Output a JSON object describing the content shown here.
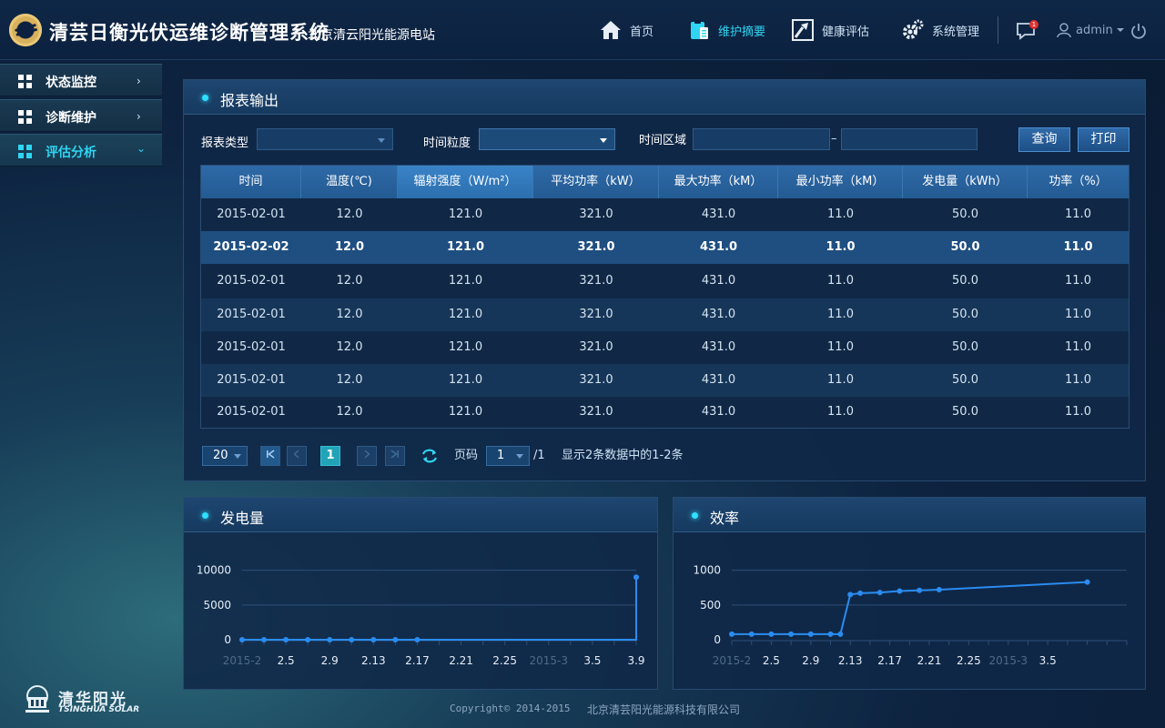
{
  "header": {
    "title": "清芸日衡光伏运维诊断管理系统",
    "subtitle": "北京清云阳光能源电站",
    "nav": [
      {
        "label": "首页",
        "icon": "home-icon",
        "active": false
      },
      {
        "label": "维护摘要",
        "icon": "clipboard-icon",
        "active": true
      },
      {
        "label": "健康评估",
        "icon": "trend-icon",
        "active": false
      },
      {
        "label": "系统管理",
        "icon": "gears-icon",
        "active": false
      }
    ],
    "message_badge": "1",
    "user": "admin"
  },
  "sidebar": {
    "items": [
      {
        "label": "状态监控",
        "chevron": "›"
      },
      {
        "label": "诊断维护",
        "chevron": "›"
      },
      {
        "label": "评估分析",
        "chevron": "⌄"
      }
    ],
    "brand_cn": "清华阳光",
    "brand_en": "TSINGHUA SOLAR"
  },
  "report": {
    "title": "报表输出",
    "filters": {
      "type_label": "报表类型",
      "type_value": "",
      "granularity_label": "时间粒度",
      "granularity_value": "",
      "range_label": "时间区域",
      "range_start": "",
      "range_end": "",
      "range_sep": "–"
    },
    "buttons": {
      "query": "查询",
      "print": "打印"
    },
    "columns": [
      "时间",
      "温度(℃)",
      "辐射强度（W/m²）",
      "平均功率（kW）",
      "最大功率（kM）",
      "最小功率（kM）",
      "发电量（kWh）",
      "功率（%）"
    ],
    "rows": [
      [
        "2015-02-01",
        "12.0",
        "121.0",
        "321.0",
        "431.0",
        "11.0",
        "50.0",
        "11.0"
      ],
      [
        "2015-02-02",
        "12.0",
        "121.0",
        "321.0",
        "431.0",
        "11.0",
        "50.0",
        "11.0"
      ],
      [
        "2015-02-01",
        "12.0",
        "121.0",
        "321.0",
        "431.0",
        "11.0",
        "50.0",
        "11.0"
      ],
      [
        "2015-02-01",
        "12.0",
        "121.0",
        "321.0",
        "431.0",
        "11.0",
        "50.0",
        "11.0"
      ],
      [
        "2015-02-01",
        "12.0",
        "121.0",
        "321.0",
        "431.0",
        "11.0",
        "50.0",
        "11.0"
      ],
      [
        "2015-02-01",
        "12.0",
        "121.0",
        "321.0",
        "431.0",
        "11.0",
        "50.0",
        "11.0"
      ],
      [
        "2015-02-01",
        "12.0",
        "121.0",
        "321.0",
        "431.0",
        "11.0",
        "50.0",
        "11.0"
      ]
    ],
    "pagination": {
      "page_size": "20",
      "current_page": "1",
      "page_label": "页码",
      "page_value": "1",
      "total_pages": "/1",
      "summary": "显示2条数据中的1-2条"
    }
  },
  "chart_data": [
    {
      "type": "line",
      "title": "发电量",
      "x_ticks": [
        "2015-2",
        "2.5",
        "2.9",
        "2.13",
        "2.17",
        "2.21",
        "2.25",
        "2015-3",
        "3.5",
        "3.9"
      ],
      "x_ticks_dim": [
        "2015-2",
        "2015-3"
      ],
      "y_ticks": [
        0,
        5000,
        10000
      ],
      "ylim": [
        0,
        11000
      ],
      "series": [
        {
          "values": [
            {
              "x": "2015-02-01",
              "y": 0
            },
            {
              "x": "2015-02-03",
              "y": 0
            },
            {
              "x": "2015-02-05",
              "y": 0
            },
            {
              "x": "2015-02-07",
              "y": 0
            },
            {
              "x": "2015-02-09",
              "y": 0
            },
            {
              "x": "2015-02-11",
              "y": 0
            },
            {
              "x": "2015-02-13",
              "y": 0
            },
            {
              "x": "2015-02-15",
              "y": 0
            },
            {
              "x": "2015-02-17",
              "y": 0
            },
            {
              "x": "2015-03-09",
              "y": 0
            },
            {
              "x": "2015-03-09",
              "y": 9000
            }
          ]
        }
      ],
      "grid": true,
      "color": "#2a8cf0"
    },
    {
      "type": "line",
      "title": "效率",
      "x_ticks": [
        "2015-2",
        "2.5",
        "2.9",
        "2.13",
        "2.17",
        "2.21",
        "2.25",
        "2015-3",
        "3.5"
      ],
      "x_ticks_dim": [
        "2015-2",
        "2015-3"
      ],
      "y_ticks": [
        0,
        500,
        1000
      ],
      "ylim": [
        0,
        1100
      ],
      "series": [
        {
          "values": [
            {
              "x": "2015-02-01",
              "y": 80
            },
            {
              "x": "2015-02-03",
              "y": 80
            },
            {
              "x": "2015-02-05",
              "y": 80
            },
            {
              "x": "2015-02-07",
              "y": 80
            },
            {
              "x": "2015-02-09",
              "y": 80
            },
            {
              "x": "2015-02-11",
              "y": 80
            },
            {
              "x": "2015-02-12",
              "y": 80
            },
            {
              "x": "2015-02-13",
              "y": 650
            },
            {
              "x": "2015-02-14",
              "y": 670
            },
            {
              "x": "2015-02-16",
              "y": 680
            },
            {
              "x": "2015-02-18",
              "y": 700
            },
            {
              "x": "2015-02-20",
              "y": 710
            },
            {
              "x": "2015-02-22",
              "y": 720
            },
            {
              "x": "2015-03-09",
              "y": 830
            }
          ]
        }
      ],
      "grid": true,
      "color": "#2a8cf0"
    }
  ],
  "footer": {
    "copyright": "Copyright© 2014-2015",
    "company": "北京清芸阳光能源科技有限公司"
  },
  "colors": {
    "accent": "#2fd5f2",
    "table_header": "#2e6aa8",
    "line": "#2a8cf0"
  }
}
